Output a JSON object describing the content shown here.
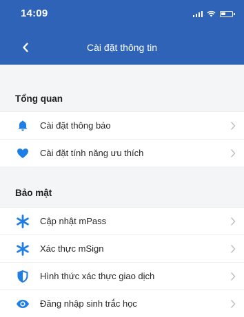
{
  "status": {
    "time": "14:09"
  },
  "header": {
    "title": "Cài đặt thông tin"
  },
  "sections": [
    {
      "title": "Tổng quan",
      "items": [
        {
          "label": "Cài đặt thông báo",
          "icon": "bell-icon"
        },
        {
          "label": "Cài đặt tính năng ưu thích",
          "icon": "heart-icon"
        }
      ]
    },
    {
      "title": "Bảo mật",
      "items": [
        {
          "label": "Cập nhật mPass",
          "icon": "asterisk-icon"
        },
        {
          "label": "Xác thực mSign",
          "icon": "asterisk-icon"
        },
        {
          "label": "Hình thức xác thực giao dịch",
          "icon": "shield-icon"
        },
        {
          "label": "Đăng nhập sinh trắc học",
          "icon": "eye-icon"
        }
      ]
    }
  ],
  "colors": {
    "primary": "#2f63b7",
    "icon_blue": "#1f7de6",
    "background": "#f4f5f7"
  }
}
